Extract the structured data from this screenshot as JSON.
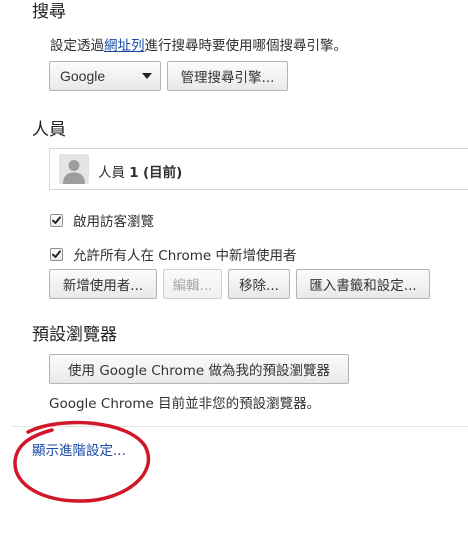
{
  "search": {
    "title": "搜尋",
    "description_prefix": "設定透過",
    "description_link": "網址列",
    "description_suffix": "進行搜尋時要使用哪個搜尋引擎。",
    "engine_selected": "Google",
    "manage_button": "管理搜尋引擎..."
  },
  "people": {
    "title": "人員",
    "profile_name": "人員",
    "profile_number": "1",
    "profile_status": "(目前)",
    "guest_checkbox_label": "啟用訪客瀏覽",
    "guest_checked": true,
    "add_anyone_checkbox_label": "允許所有人在 Chrome 中新增使用者",
    "add_anyone_checked": true,
    "buttons": {
      "add": "新增使用者...",
      "edit": "編輯...",
      "remove": "移除...",
      "import": "匯入書籤和設定..."
    }
  },
  "default_browser": {
    "title": "預設瀏覽器",
    "make_default_button": "使用 Google Chrome 做為我的預設瀏覽器",
    "status": "Google Chrome 目前並非您的預設瀏覽器。"
  },
  "advanced": {
    "show_link": "顯示進階設定..."
  },
  "colors": {
    "link": "#1a4aa6",
    "annotation": "#d0182a"
  }
}
